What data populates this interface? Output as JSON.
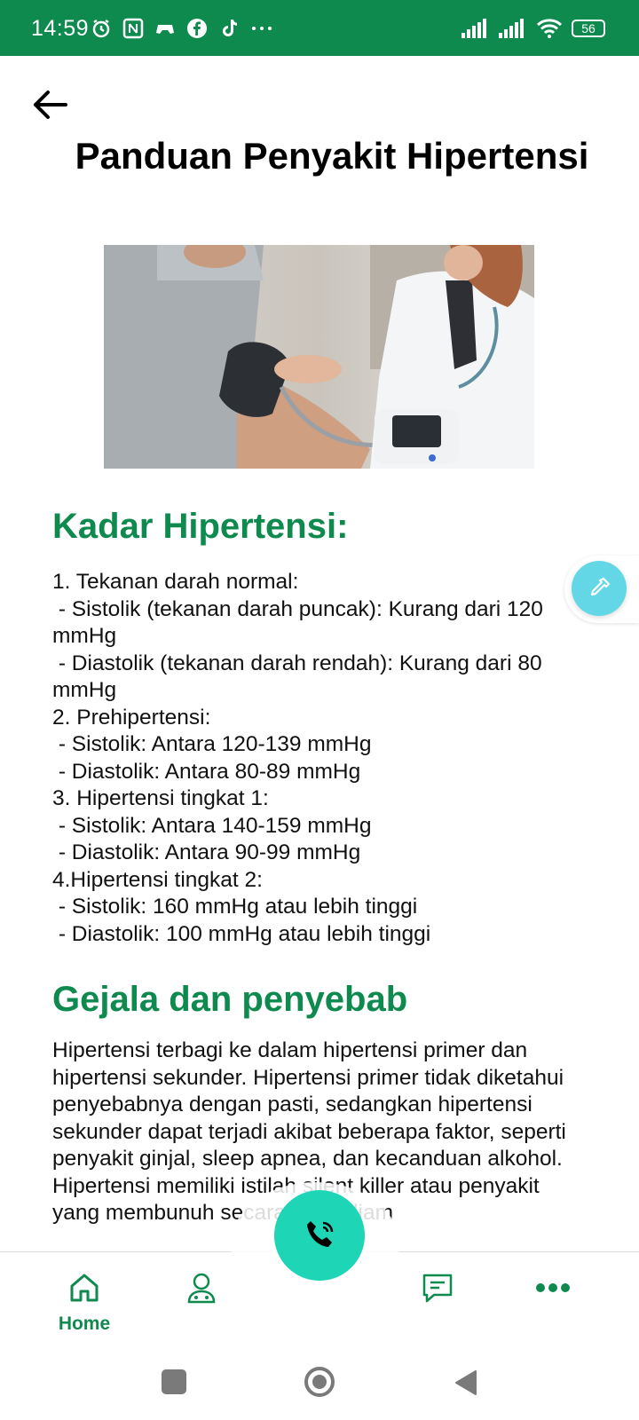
{
  "status_bar": {
    "time": "14:59",
    "battery": "56",
    "icons_left": [
      "alarm-icon",
      "nfc-icon",
      "game-icon",
      "facebook-icon",
      "tiktok-icon",
      "more-dots-icon"
    ],
    "icons_right": [
      "signal-icon",
      "signal-icon",
      "wifi-icon",
      "battery-icon"
    ]
  },
  "header": {
    "title": "Panduan Penyakit Hipertensi"
  },
  "sections": {
    "kadar": {
      "title": "Kadar Hipertensi:",
      "lines": [
        "1. Tekanan darah normal:",
        " - Sistolik (tekanan darah puncak): Kurang dari 120 mmHg",
        " - Diastolik (tekanan darah rendah): Kurang dari 80 mmHg",
        "2. Prehipertensi:",
        " - Sistolik: Antara 120-139 mmHg",
        " - Diastolik: Antara 80-89 mmHg",
        "3. Hipertensi tingkat 1:",
        " - Sistolik: Antara 140-159 mmHg",
        " - Diastolik: Antara 90-99 mmHg",
        "4.Hipertensi tingkat 2:",
        " - Sistolik: 160 mmHg atau lebih tinggi",
        " - Diastolik: 100 mmHg atau lebih tinggi"
      ]
    },
    "gejala": {
      "title": "Gejala dan penyebab",
      "paragraph1": "Hipertensi terbagi ke dalam hipertensi primer dan hipertensi sekunder. Hipertensi primer tidak diketahui penyebabnya dengan pasti, sedangkan hipertensi sekunder dapat terjadi akibat beberapa faktor, seperti penyakit ginjal, sleep apnea, dan kecanduan alkohol.",
      "paragraph2": "Hipertensi memiliki istilah silent killer atau penyakit yang membunuh secara diam-diam"
    }
  },
  "bottom_nav": {
    "home_label": "Home",
    "icons": [
      "home-icon",
      "doctor-icon",
      "chat-icon",
      "more-icon"
    ]
  },
  "colors": {
    "brand_green": "#0e8a4f",
    "call_button": "#1ed6b5",
    "dropper_button": "#63d7e6"
  }
}
